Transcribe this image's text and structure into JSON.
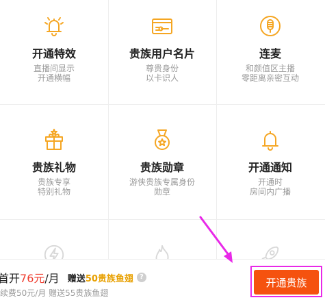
{
  "privileges": [
    {
      "title": "开通特效",
      "desc": [
        "直播间显示",
        "开通横幅"
      ],
      "icon": "bell-icon"
    },
    {
      "title": "贵族用户名片",
      "desc": [
        "尊贵身份",
        "以卡识人"
      ],
      "icon": "id-card-icon"
    },
    {
      "title": "连麦",
      "desc": [
        "和颜值区主播",
        "零距离亲密互动"
      ],
      "icon": "microphone-icon"
    },
    {
      "title": "贵族礼物",
      "desc": [
        "贵族专享",
        "特别礼物"
      ],
      "icon": "gift-box-icon"
    },
    {
      "title": "贵族勋章",
      "desc": [
        "游侠贵族专属身份",
        "勋章"
      ],
      "icon": "medal-icon"
    },
    {
      "title": "开通通知",
      "desc": [
        "开通时",
        "房间内广播"
      ],
      "icon": "bell-icon"
    }
  ],
  "partial_icons": [
    "lightning-icon",
    "flame-icon",
    "rocket-icon"
  ],
  "footer": {
    "price_prefix": "首开",
    "price_value": "76元",
    "price_suffix": "/月",
    "gift_prefix": "赠送",
    "gift_value": "50贵族鱼翅",
    "help": "?",
    "renew_text": "续费50元/月   赠送55贵族鱼翅"
  },
  "cta_label": "开通贵族",
  "colors": {
    "accent_orange": "#f5520f",
    "icon_orange": "#f5a623",
    "price_red": "#ef3d2f",
    "gift_gold": "#e8a000",
    "highlight_magenta": "#e829e8"
  }
}
